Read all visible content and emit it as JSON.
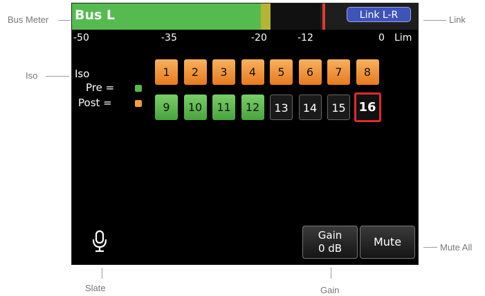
{
  "callouts": {
    "bus_meter": "Bus Meter",
    "link": "Link",
    "iso": "Iso",
    "mute_all": "Mute All",
    "slate": "Slate",
    "gain": "Gain"
  },
  "meter": {
    "title": "Bus L",
    "link_button": "Link L-R",
    "scale": [
      "-50",
      "-35",
      "-20",
      "-12",
      "0",
      "Lim"
    ],
    "colors": {
      "signal": "#55bb4f",
      "warning": "#b5b435",
      "peak": "#e03a2e"
    }
  },
  "iso": {
    "title": "Iso",
    "pre_label": "Pre =",
    "post_label": "Post =",
    "pre_color": "#55bb4f",
    "post_color": "#f0a238",
    "channels": [
      {
        "label": "1",
        "state": "post"
      },
      {
        "label": "2",
        "state": "post"
      },
      {
        "label": "3",
        "state": "post"
      },
      {
        "label": "4",
        "state": "post"
      },
      {
        "label": "5",
        "state": "post"
      },
      {
        "label": "6",
        "state": "post"
      },
      {
        "label": "7",
        "state": "post"
      },
      {
        "label": "8",
        "state": "post"
      },
      {
        "label": "9",
        "state": "pre"
      },
      {
        "label": "10",
        "state": "pre"
      },
      {
        "label": "11",
        "state": "pre"
      },
      {
        "label": "12",
        "state": "pre"
      },
      {
        "label": "13",
        "state": "off"
      },
      {
        "label": "14",
        "state": "off"
      },
      {
        "label": "15",
        "state": "off"
      },
      {
        "label": "16",
        "state": "selected"
      }
    ]
  },
  "controls": {
    "slate_icon": "microphone-icon",
    "gain_label": "Gain",
    "gain_value": "0 dB",
    "mute_label": "Mute"
  }
}
